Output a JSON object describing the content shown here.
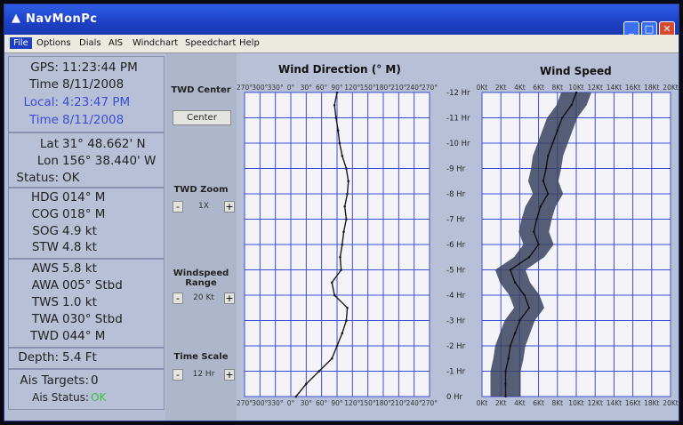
{
  "window": {
    "title": "NavMonPc"
  },
  "menu": [
    "File",
    "Options",
    "Dials",
    "AIS",
    "Windchart",
    "Speedchart",
    "Help"
  ],
  "time": {
    "gps_label": "GPS:",
    "gps": "11:23:44 PM",
    "time_label": "Time",
    "time": "8/11/2008",
    "local_label": "Local:",
    "local": "4:23:47 PM",
    "localdate_label": "Time",
    "localdate": "8/11/2008"
  },
  "position": {
    "lat_label": "Lat",
    "lat": "31° 48.662' N",
    "lon_label": "Lon",
    "lon": "156° 38.440' W",
    "status_label": "Status:",
    "status": "OK"
  },
  "motion": [
    {
      "label": "HDG",
      "value": "014° M"
    },
    {
      "label": "COG",
      "value": "018° M"
    },
    {
      "label": "SOG",
      "value": "4.9 kt"
    },
    {
      "label": "STW",
      "value": "4.8 kt"
    }
  ],
  "wind": [
    {
      "label": "AWS",
      "value": "5.8 kt"
    },
    {
      "label": "AWA",
      "value": "005° Stbd"
    },
    {
      "label": "TWS",
      "value": "1.0 kt"
    },
    {
      "label": "TWA",
      "value": "030° Stbd"
    },
    {
      "label": "TWD",
      "value": "044° M"
    }
  ],
  "depth": {
    "label": "Depth:",
    "value": "5.4 Ft"
  },
  "ais": {
    "targets_label": "Ais Targets:",
    "targets": "0",
    "status_label": "Ais Status:",
    "status": "OK"
  },
  "controls": {
    "twd_center_title": "TWD Center",
    "center_button": "Center",
    "twd_zoom_title": "TWD Zoom",
    "twd_zoom_value": "1X",
    "windspeed_range_title": "Windspeed Range",
    "windspeed_range_value": "20 Kt",
    "time_scale_title": "Time Scale",
    "time_scale_value": "12 Hr",
    "minus": "-",
    "plus": "+"
  },
  "colors": {
    "titlebar": "#1c3fc4",
    "grid": "#3a4ed8",
    "trace": "#1a1a1a",
    "speed_fill": "#3a4260"
  },
  "chart_data": [
    {
      "type": "line",
      "title": "Wind Direction (° M)",
      "x_ticks": [
        "270°",
        "300°",
        "330°",
        "0°",
        "30°",
        "60°",
        "90°",
        "120°",
        "150°",
        "180°",
        "210°",
        "240°",
        "270°"
      ],
      "y_ticks": [
        "-12 Hr",
        "-11 Hr",
        "-10 Hr",
        "-9 Hr",
        "-8 Hr",
        "-7 Hr",
        "-6 Hr",
        "-5 Hr",
        "-4 Hr",
        "-3 Hr",
        "-2 Hr",
        "-1 Hr",
        "0 Hr"
      ],
      "xlim": [
        270,
        630
      ],
      "ylim": [
        -12,
        0
      ],
      "series": [
        {
          "x": [
            -12,
            -11.5,
            -11,
            -10.5,
            -10,
            -9.5,
            -9,
            -8.5,
            -8,
            -7.5,
            -7,
            -6.5,
            -6,
            -5.5,
            -5,
            -4.5,
            -4,
            -3.5,
            -3,
            -2.5,
            -2,
            -1.5,
            -1,
            -0.5,
            0
          ],
          "y": [
            90,
            85,
            88,
            92,
            95,
            100,
            108,
            112,
            110,
            105,
            108,
            103,
            100,
            96,
            98,
            80,
            85,
            110,
            108,
            100,
            90,
            80,
            55,
            30,
            10
          ]
        }
      ]
    },
    {
      "type": "area",
      "title": "Wind Speed",
      "x_ticks": [
        "0Kt",
        "2Kt",
        "4Kt",
        "6Kt",
        "8Kt",
        "10Kt",
        "12Kt",
        "14Kt",
        "16Kt",
        "18Kt",
        "20Kt"
      ],
      "xlim": [
        0,
        20
      ],
      "ylim": [
        -12,
        0
      ],
      "series": [
        {
          "x": [
            -12,
            -11.5,
            -11,
            -10.5,
            -10,
            -9.5,
            -9,
            -8.5,
            -8,
            -7.5,
            -7,
            -6.5,
            -6,
            -5.5,
            -5,
            -4.5,
            -4,
            -3.5,
            -3,
            -2.5,
            -2,
            -1.5,
            -1,
            -0.5,
            0
          ],
          "y": [
            10,
            9.5,
            8.5,
            8,
            7.5,
            7,
            6.8,
            6.5,
            7,
            6.2,
            5.8,
            5.5,
            6,
            5,
            3,
            3.5,
            4.5,
            5,
            4,
            3.5,
            3,
            2.8,
            2.5,
            2.5,
            2.5
          ]
        }
      ]
    }
  ]
}
